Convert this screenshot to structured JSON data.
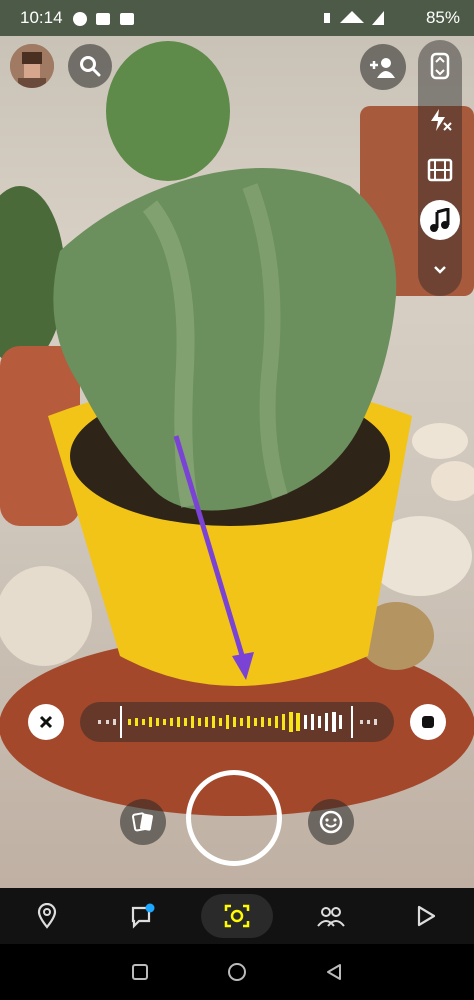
{
  "status_bar": {
    "time": "10:14",
    "battery": "85%"
  },
  "camera": {
    "top_left": {
      "avatar": "avatar",
      "search_icon": "search-icon"
    },
    "right_rail": {
      "add_friend_icon": "add-friend-icon",
      "flip_camera_icon": "flip-camera-icon",
      "flash_off_icon": "flash-off-icon",
      "video_icon": "video-icon",
      "music_icon": "music-icon",
      "more_icon": "chevron-down-icon"
    },
    "audio_scrubber": {
      "close_icon": "close-icon",
      "stop_icon": "stop-icon"
    },
    "capture_row": {
      "memories_icon": "memories-icon",
      "lenses_icon": "smiley-icon"
    }
  },
  "bottom_nav": {
    "items": [
      "map-icon",
      "chat-icon",
      "camera-icon",
      "friends-icon",
      "play-icon"
    ]
  },
  "system_nav": {
    "buttons": [
      "recent-apps",
      "home",
      "back"
    ]
  },
  "colors": {
    "accent_yellow": "#FFFC00",
    "annotation_arrow": "#7a43d6"
  }
}
